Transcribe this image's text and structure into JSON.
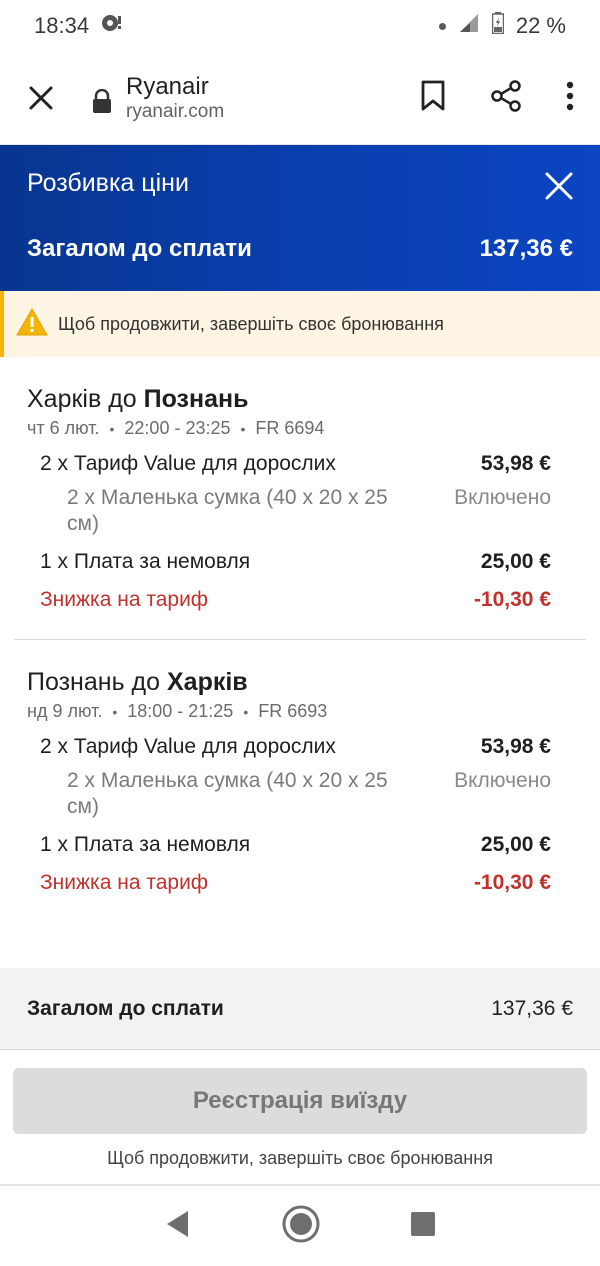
{
  "status": {
    "time": "18:34",
    "battery": "22 %"
  },
  "browser": {
    "site_name": "Ryanair",
    "site_url": "ryanair.com"
  },
  "header": {
    "title": "Розбивка ціни",
    "total_label": "Загалом до сплати",
    "total_value": "137,36 €"
  },
  "warning": {
    "text": "Щоб продовжити, завершіть своє бронювання"
  },
  "flights": [
    {
      "route_from": "Харків до ",
      "route_to": "Познань",
      "date": "чт 6 лют.",
      "time": "22:00 - 23:25",
      "flight_no": "FR 6694",
      "fare_label": "2 x Тариф Value для дорослих",
      "fare_value": "53,98 €",
      "bag_label": "2 x Маленька сумка (40 x 20 x 25 см)",
      "bag_value": "Включено",
      "infant_label": "1 x Плата за немовля",
      "infant_value": "25,00 €",
      "discount_label": "Знижка на тариф",
      "discount_value": "-10,30 €"
    },
    {
      "route_from": "Познань до ",
      "route_to": "Харків",
      "date": "нд 9 лют.",
      "time": "18:00 - 21:25",
      "flight_no": "FR 6693",
      "fare_label": "2 x Тариф Value для дорослих",
      "fare_value": "53,98 €",
      "bag_label": "2 x Маленька сумка (40 x 20 x 25 см)",
      "bag_value": "Включено",
      "infant_label": "1 x Плата за немовля",
      "infant_value": "25,00 €",
      "discount_label": "Знижка на тариф",
      "discount_value": "-10,30 €"
    }
  ],
  "summary": {
    "total_label": "Загалом до сплати",
    "total_value": "137,36 €"
  },
  "checkin": {
    "button_label": "Реєстрація виїзду",
    "note": "Щоб продовжити, завершіть своє бронювання"
  },
  "colors": {
    "header_blue": "#073590",
    "discount_red": "#c0312b",
    "warning_amber": "#f4b400"
  }
}
